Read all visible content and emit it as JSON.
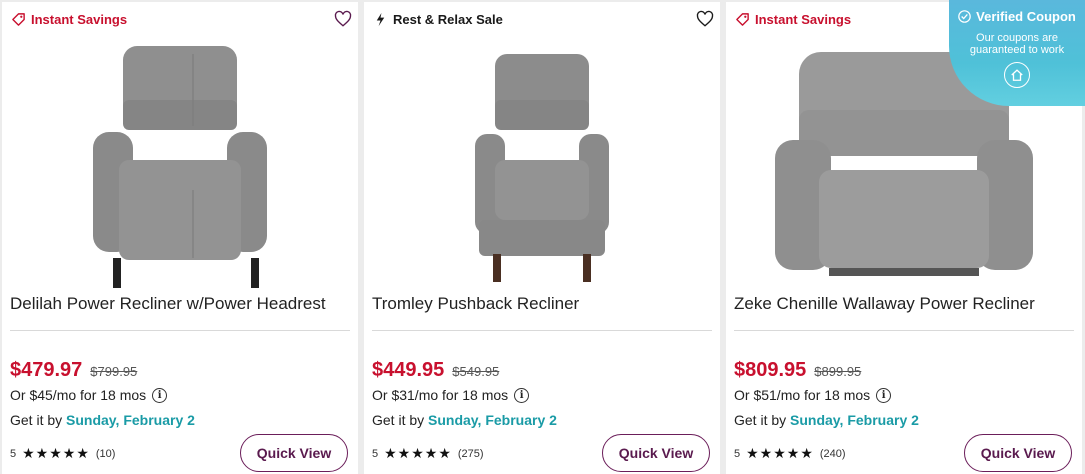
{
  "products": [
    {
      "badge": "Instant Savings",
      "badge_icon": "tag-icon",
      "title": "Delilah Power Recliner w/Power Headrest",
      "price": "$479.97",
      "was": "$799.95",
      "finance": "Or $45/mo for 18 mos",
      "delivery_prefix": "Get it by",
      "delivery_date": "Sunday, February 2",
      "rating": "5",
      "stars": "★★★★★",
      "reviews": "(10)",
      "button": "Quick View"
    },
    {
      "badge": "Rest & Relax Sale",
      "badge_icon": "lightning-icon",
      "title": "Tromley Pushback Recliner",
      "price": "$449.95",
      "was": "$549.95",
      "finance": "Or $31/mo for 18 mos",
      "delivery_prefix": "Get it by",
      "delivery_date": "Sunday, February 2",
      "rating": "5",
      "stars": "★★★★★",
      "reviews": "(275)",
      "button": "Quick View"
    },
    {
      "badge": "Instant Savings",
      "badge_icon": "tag-icon",
      "title": "Zeke Chenille Wallaway Power Recliner",
      "price": "$809.95",
      "was": "$899.95",
      "finance": "Or $51/mo for 18 mos",
      "delivery_prefix": "Get it by",
      "delivery_date": "Sunday, February 2",
      "rating": "5",
      "stars": "★★★★★",
      "reviews": "(240)",
      "button": "Quick View"
    }
  ],
  "coupon_widget": {
    "title": "Verified Coupon",
    "subtitle": "Our coupons are guaranteed to work",
    "icon": "home-icon"
  },
  "colors": {
    "sale_red": "#c8102e",
    "delivery_teal": "#1a9ba6",
    "button_purple": "#6b1e5a",
    "coupon_blue": "#4fc1d8"
  },
  "info_glyph": "i"
}
